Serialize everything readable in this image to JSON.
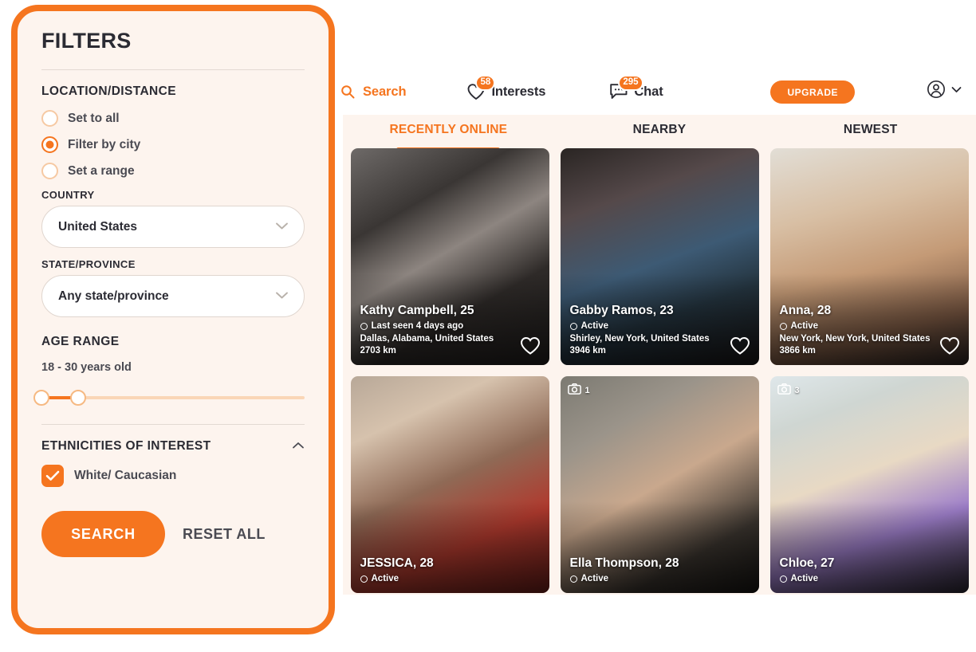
{
  "theme": {
    "accent": "#F5751F",
    "panel_bg": "#FDF4EE",
    "content_bg": "#FDF4EE",
    "text_dark": "#2b2b33"
  },
  "nav": {
    "items": [
      {
        "label": "Search",
        "icon": "search-icon",
        "badge": null,
        "active": true
      },
      {
        "label": "Interests",
        "icon": "heart-icon",
        "badge": "58",
        "active": false
      },
      {
        "label": "Chat",
        "icon": "chat-icon",
        "badge": "295",
        "active": false
      }
    ],
    "upgrade_label": "UPGRADE",
    "account_icon": "account-circle-icon",
    "account_chevron": "chevron-down-icon"
  },
  "tabs": [
    {
      "label": "RECENTLY ONLINE",
      "active": true
    },
    {
      "label": "NEARBY",
      "active": false
    },
    {
      "label": "NEWEST",
      "active": false
    }
  ],
  "cards": [
    {
      "name": "Kathy Campbell, 25",
      "status": "Last seen 4 days ago",
      "location": "Dallas, Alabama, United States",
      "distance": "2703 km",
      "photo_count": null,
      "has_heart": true
    },
    {
      "name": "Gabby Ramos, 23",
      "status": "Active",
      "location": "Shirley, New York, United States",
      "distance": "3946 km",
      "photo_count": null,
      "has_heart": true
    },
    {
      "name": "Anna, 28",
      "status": "Active",
      "location": "New York, New York, United States",
      "distance": "3866 km",
      "photo_count": null,
      "has_heart": true
    },
    {
      "name": "JESSICA, 28",
      "status": "Active",
      "location": "",
      "distance": "",
      "photo_count": null,
      "has_heart": false
    },
    {
      "name": "Ella Thompson, 28",
      "status": "Active",
      "location": "",
      "distance": "",
      "photo_count": "1",
      "has_heart": false
    },
    {
      "name": "Chloe, 27",
      "status": "Active",
      "location": "",
      "distance": "",
      "photo_count": "3",
      "has_heart": false
    }
  ],
  "filters": {
    "title": "FILTERS",
    "location_section": {
      "heading": "LOCATION/DISTANCE",
      "options": [
        {
          "label": "Set to all",
          "selected": false
        },
        {
          "label": "Filter by city",
          "selected": true
        },
        {
          "label": "Set a range",
          "selected": false
        }
      ],
      "country_label": "COUNTRY",
      "country_value": "United States",
      "state_label": "STATE/PROVINCE",
      "state_value": "Any state/province"
    },
    "age_section": {
      "heading": "AGE RANGE",
      "value_text": "18 - 30 years old",
      "min": 18,
      "max": 30,
      "handle_left_pct": 0,
      "handle_right_pct": 14
    },
    "ethnicity_section": {
      "heading": "ETHNICITIES OF INTEREST",
      "collapse_icon": "chevron-up-icon",
      "options": [
        {
          "label": "White/ Caucasian",
          "checked": true
        }
      ]
    },
    "search_label": "SEARCH",
    "reset_label": "RESET ALL"
  }
}
